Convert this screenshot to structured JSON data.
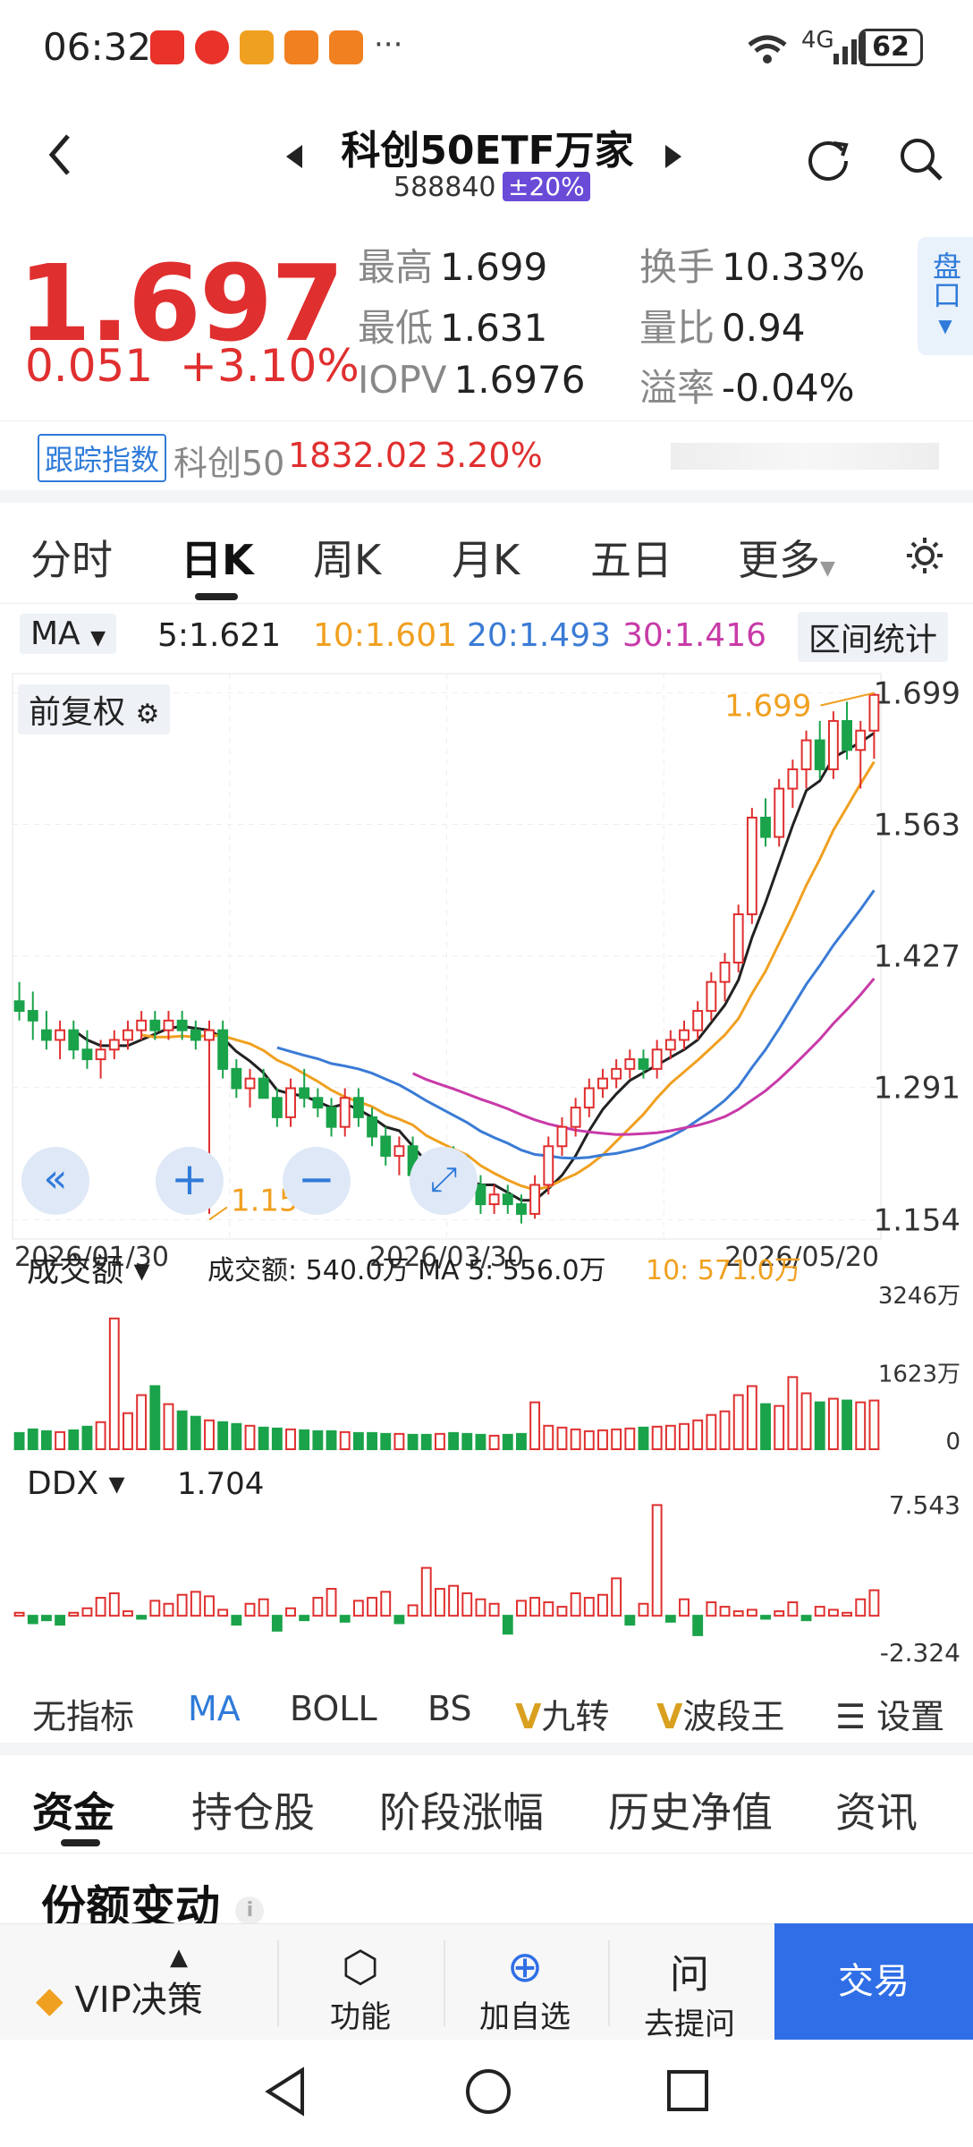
{
  "status_bar": {
    "time": "06:32",
    "network": "4G",
    "battery": "62"
  },
  "header": {
    "title": "科创50ETF万家",
    "code": "588840",
    "limit_badge": "±20%"
  },
  "quote": {
    "price": "1.697",
    "change": "0.051",
    "change_pct": "+3.10%",
    "high_label": "最高",
    "high": "1.699",
    "low_label": "最低",
    "low": "1.631",
    "iopv_label": "IOPV",
    "iopv": "1.6976",
    "turnover_label": "换手",
    "turnover": "10.33%",
    "vol_ratio_label": "量比",
    "vol_ratio": "0.94",
    "premium_label": "溢率",
    "premium": "-0.04%",
    "panel_tab": "盘口"
  },
  "tracking": {
    "tag": "跟踪指数",
    "index_name": "科创50",
    "index_value": "1832.02",
    "index_change": "3.20%"
  },
  "period_tabs": [
    "分时",
    "日K",
    "周K",
    "月K",
    "五日",
    "更多"
  ],
  "ma_line": {
    "selector": "MA",
    "ma5": "5:1.621",
    "ma10": "10:1.601",
    "ma20": "20:1.493",
    "ma30": "30:1.416",
    "stats_button": "区间统计"
  },
  "chart_labels": {
    "adjust": "前复权",
    "y_ticks": [
      "1.699",
      "1.563",
      "1.427",
      "1.291",
      "1.154"
    ],
    "x_ticks": [
      "2026/01/30",
      "2026/03/30",
      "2026/05/20"
    ],
    "max_label": "1.699",
    "min_label": "1.154"
  },
  "volume": {
    "selector": "成交额",
    "info_label": "成交额:",
    "info_value": "540.0万",
    "ma5_label": "MA 5:",
    "ma5_value": "556.0万",
    "ma10_label": "10:",
    "ma10_value": "571.0万",
    "y_ticks": [
      "3246万",
      "1623万",
      "0"
    ]
  },
  "ddx": {
    "selector": "DDX",
    "value": "1.704",
    "y_ticks": [
      "7.543",
      "-2.324"
    ]
  },
  "indicators": [
    "无指标",
    "MA",
    "BOLL",
    "BS",
    "九转",
    "波段王",
    "设置"
  ],
  "bottom_tabs": [
    "资金",
    "持仓股",
    "阶段涨幅",
    "历史净值",
    "资讯"
  ],
  "section_title": "份额变动",
  "bottom_bar": {
    "vip": "VIP决策",
    "func": "功能",
    "add": "加自选",
    "ask": "去提问",
    "trade": "交易"
  },
  "colors": {
    "up": "#e02f2f",
    "down": "#1aa34a",
    "ma5": "#222222",
    "ma10": "#f0a020",
    "ma20": "#3a7bd5",
    "ma30": "#c83aa8"
  },
  "chart_data": {
    "type": "candlestick",
    "title": "",
    "ylim": [
      1.154,
      1.699
    ],
    "x_ticks": [
      "2026/01/30",
      "2026/03/30",
      "2026/05/20"
    ],
    "ohlc": [
      [
        1.38,
        1.4,
        1.36,
        1.37
      ],
      [
        1.37,
        1.39,
        1.34,
        1.36
      ],
      [
        1.35,
        1.37,
        1.33,
        1.34
      ],
      [
        1.34,
        1.36,
        1.32,
        1.35
      ],
      [
        1.35,
        1.36,
        1.32,
        1.33
      ],
      [
        1.33,
        1.35,
        1.31,
        1.32
      ],
      [
        1.32,
        1.34,
        1.3,
        1.33
      ],
      [
        1.33,
        1.35,
        1.32,
        1.34
      ],
      [
        1.34,
        1.36,
        1.33,
        1.35
      ],
      [
        1.35,
        1.37,
        1.34,
        1.36
      ],
      [
        1.36,
        1.37,
        1.34,
        1.35
      ],
      [
        1.35,
        1.37,
        1.34,
        1.36
      ],
      [
        1.36,
        1.37,
        1.34,
        1.35
      ],
      [
        1.35,
        1.36,
        1.33,
        1.34
      ],
      [
        1.34,
        1.36,
        1.16,
        1.35
      ],
      [
        1.35,
        1.36,
        1.3,
        1.31
      ],
      [
        1.31,
        1.32,
        1.28,
        1.29
      ],
      [
        1.29,
        1.31,
        1.27,
        1.3
      ],
      [
        1.3,
        1.31,
        1.28,
        1.28
      ],
      [
        1.28,
        1.29,
        1.25,
        1.26
      ],
      [
        1.26,
        1.3,
        1.25,
        1.29
      ],
      [
        1.29,
        1.31,
        1.27,
        1.28
      ],
      [
        1.28,
        1.29,
        1.26,
        1.27
      ],
      [
        1.27,
        1.28,
        1.24,
        1.25
      ],
      [
        1.25,
        1.29,
        1.24,
        1.28
      ],
      [
        1.28,
        1.29,
        1.25,
        1.26
      ],
      [
        1.26,
        1.27,
        1.23,
        1.24
      ],
      [
        1.24,
        1.25,
        1.21,
        1.22
      ],
      [
        1.22,
        1.24,
        1.2,
        1.23
      ],
      [
        1.23,
        1.24,
        1.19,
        1.2
      ],
      [
        1.2,
        1.21,
        1.17,
        1.18
      ],
      [
        1.18,
        1.22,
        1.17,
        1.21
      ],
      [
        1.21,
        1.23,
        1.19,
        1.2
      ],
      [
        1.2,
        1.22,
        1.18,
        1.19
      ],
      [
        1.19,
        1.2,
        1.16,
        1.17
      ],
      [
        1.17,
        1.19,
        1.16,
        1.18
      ],
      [
        1.18,
        1.19,
        1.16,
        1.17
      ],
      [
        1.17,
        1.18,
        1.15,
        1.16
      ],
      [
        1.16,
        1.2,
        1.155,
        1.19
      ],
      [
        1.19,
        1.24,
        1.18,
        1.23
      ],
      [
        1.23,
        1.26,
        1.22,
        1.25
      ],
      [
        1.25,
        1.28,
        1.24,
        1.27
      ],
      [
        1.27,
        1.3,
        1.26,
        1.29
      ],
      [
        1.29,
        1.31,
        1.28,
        1.3
      ],
      [
        1.3,
        1.32,
        1.29,
        1.31
      ],
      [
        1.31,
        1.33,
        1.3,
        1.32
      ],
      [
        1.32,
        1.33,
        1.3,
        1.31
      ],
      [
        1.31,
        1.34,
        1.3,
        1.33
      ],
      [
        1.33,
        1.35,
        1.32,
        1.34
      ],
      [
        1.34,
        1.36,
        1.33,
        1.35
      ],
      [
        1.35,
        1.38,
        1.34,
        1.37
      ],
      [
        1.37,
        1.41,
        1.36,
        1.4
      ],
      [
        1.4,
        1.43,
        1.38,
        1.42
      ],
      [
        1.42,
        1.48,
        1.41,
        1.47
      ],
      [
        1.47,
        1.58,
        1.46,
        1.57
      ],
      [
        1.57,
        1.59,
        1.54,
        1.55
      ],
      [
        1.55,
        1.61,
        1.54,
        1.6
      ],
      [
        1.6,
        1.63,
        1.58,
        1.62
      ],
      [
        1.62,
        1.66,
        1.6,
        1.65
      ],
      [
        1.65,
        1.67,
        1.61,
        1.62
      ],
      [
        1.62,
        1.68,
        1.61,
        1.67
      ],
      [
        1.67,
        1.69,
        1.63,
        1.64
      ],
      [
        1.64,
        1.67,
        1.6,
        1.66
      ],
      [
        1.66,
        1.699,
        1.631,
        1.697
      ]
    ],
    "volume": [
      180,
      220,
      200,
      190,
      210,
      250,
      300,
      1450,
      400,
      600,
      700,
      500,
      420,
      360,
      320,
      300,
      280,
      260,
      240,
      230,
      220,
      210,
      200,
      200,
      190,
      180,
      180,
      170,
      170,
      160,
      160,
      170,
      180,
      170,
      160,
      150,
      160,
      170,
      520,
      260,
      240,
      220,
      200,
      210,
      220,
      230,
      240,
      250,
      260,
      280,
      320,
      380,
      420,
      600,
      700,
      500,
      480,
      800,
      620,
      520,
      560,
      540,
      520,
      540
    ],
    "ddx": [
      0.2,
      -0.5,
      -0.3,
      -0.6,
      0.2,
      0.5,
      1.2,
      1.5,
      0.3,
      -0.2,
      1.0,
      0.8,
      1.4,
      1.6,
      1.3,
      0.4,
      -0.6,
      0.8,
      1.1,
      -1.0,
      0.5,
      -0.3,
      1.2,
      1.8,
      -0.4,
      1.0,
      1.2,
      1.6,
      -0.5,
      0.7,
      3.2,
      1.8,
      2.0,
      1.5,
      1.1,
      0.8,
      -1.2,
      1.0,
      1.2,
      0.9,
      0.6,
      1.5,
      1.2,
      1.4,
      2.5,
      -0.6,
      0.8,
      7.4,
      -0.4,
      1.1,
      -1.3,
      0.9,
      0.6,
      0.3,
      0.4,
      -0.2,
      0.3,
      0.9,
      -0.3,
      0.6,
      0.4,
      0.2,
      1.1,
      1.704
    ]
  }
}
